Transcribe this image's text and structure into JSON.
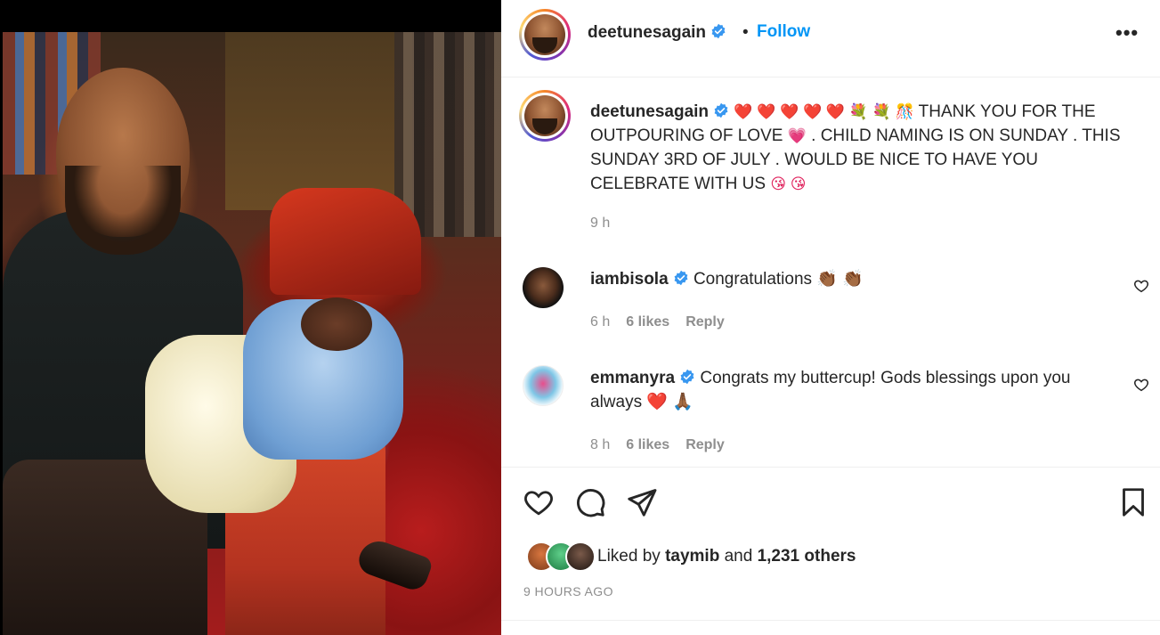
{
  "post": {
    "username": "deetunesagain",
    "follow_label": "Follow",
    "dot": "•",
    "more_label": "•••"
  },
  "caption": {
    "username": "deetunesagain",
    "emojis_before": "❤️ ❤️ ❤️ ❤️ ❤️ 💐 💐 🎊",
    "text_part1": "THANK YOU FOR THE OUTPOURING OF LOVE",
    "emoji_mid": "💗",
    "text_part2": ". CHILD NAMING IS ON SUNDAY . THIS SUNDAY 3RD OF JULY . WOULD BE NICE TO HAVE YOU CELEBRATE WITH US",
    "emojis_after": "😘 😘",
    "time": "9 h"
  },
  "comments": [
    {
      "username": "iambisola",
      "text": "Congratulations",
      "emojis": "👏🏾 👏🏾",
      "time": "6 h",
      "likes": "6 likes",
      "reply": "Reply"
    },
    {
      "username": "emmanyra",
      "text": "Congrats my buttercup! Gods blessings upon you always",
      "emojis": "❤️ 🙏🏾",
      "time": "8 h",
      "likes": "6 likes",
      "reply": "Reply"
    }
  ],
  "liked_by": {
    "prefix": "Liked by",
    "user": "taymib",
    "and": "and",
    "others": "1,231 others"
  },
  "posted_ago": "9 HOURS AGO",
  "colors": {
    "follow": "#0095f6",
    "verified": "#3897f0",
    "meta": "#8e8e8e",
    "text": "#262626"
  }
}
